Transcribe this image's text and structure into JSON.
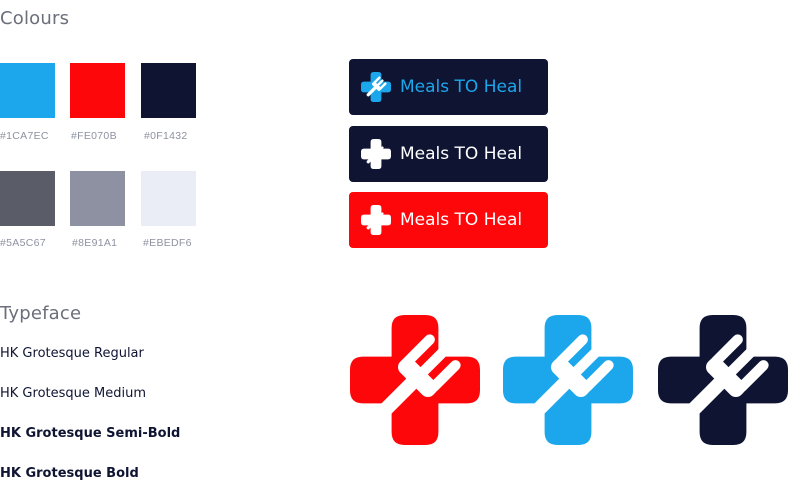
{
  "colours": {
    "title": "Colours",
    "swatches": [
      {
        "hex": "#1CA7EC",
        "label": "#1CA7EC"
      },
      {
        "hex": "#FE070B",
        "label": "#FE070B"
      },
      {
        "hex": "#0F1432",
        "label": "#0F1432"
      },
      {
        "hex": "#5A5C67",
        "label": "#5A5C67"
      },
      {
        "hex": "#8E91A1",
        "label": "#8E91A1"
      },
      {
        "hex": "#EBEDF6",
        "label": "#EBEDF6"
      }
    ]
  },
  "typeface": {
    "title": "Typeface",
    "items": [
      {
        "label": "HK Grotesque Regular",
        "weight": "regular"
      },
      {
        "label": "HK Grotesque Medium",
        "weight": "medium"
      },
      {
        "label": "HK Grotesque Semi-Bold",
        "weight": "semi-bold"
      },
      {
        "label": "HK Grotesque Bold",
        "weight": "bold"
      }
    ]
  },
  "logo_badges": [
    {
      "text": "Meals TO Heal",
      "background": "#0F1432",
      "icon_color": "#1CA7EC",
      "text_color": "#1CA7EC",
      "icon": "cross-fork-icon"
    },
    {
      "text": "Meals TO Heal",
      "background": "#0F1432",
      "icon_color": "#FFFFFF",
      "text_color": "#FFFFFF",
      "icon": "cross-fork-icon"
    },
    {
      "text": "Meals TO Heal",
      "background": "#FE070B",
      "icon_color": "#FFFFFF",
      "text_color": "#FFFFFF",
      "icon": "cross-fork-icon"
    }
  ],
  "logo_marks": [
    {
      "color": "#FE070B",
      "icon": "cross-fork-icon"
    },
    {
      "color": "#1CA7EC",
      "icon": "cross-fork-icon"
    },
    {
      "color": "#0F1432",
      "icon": "cross-fork-icon"
    }
  ]
}
